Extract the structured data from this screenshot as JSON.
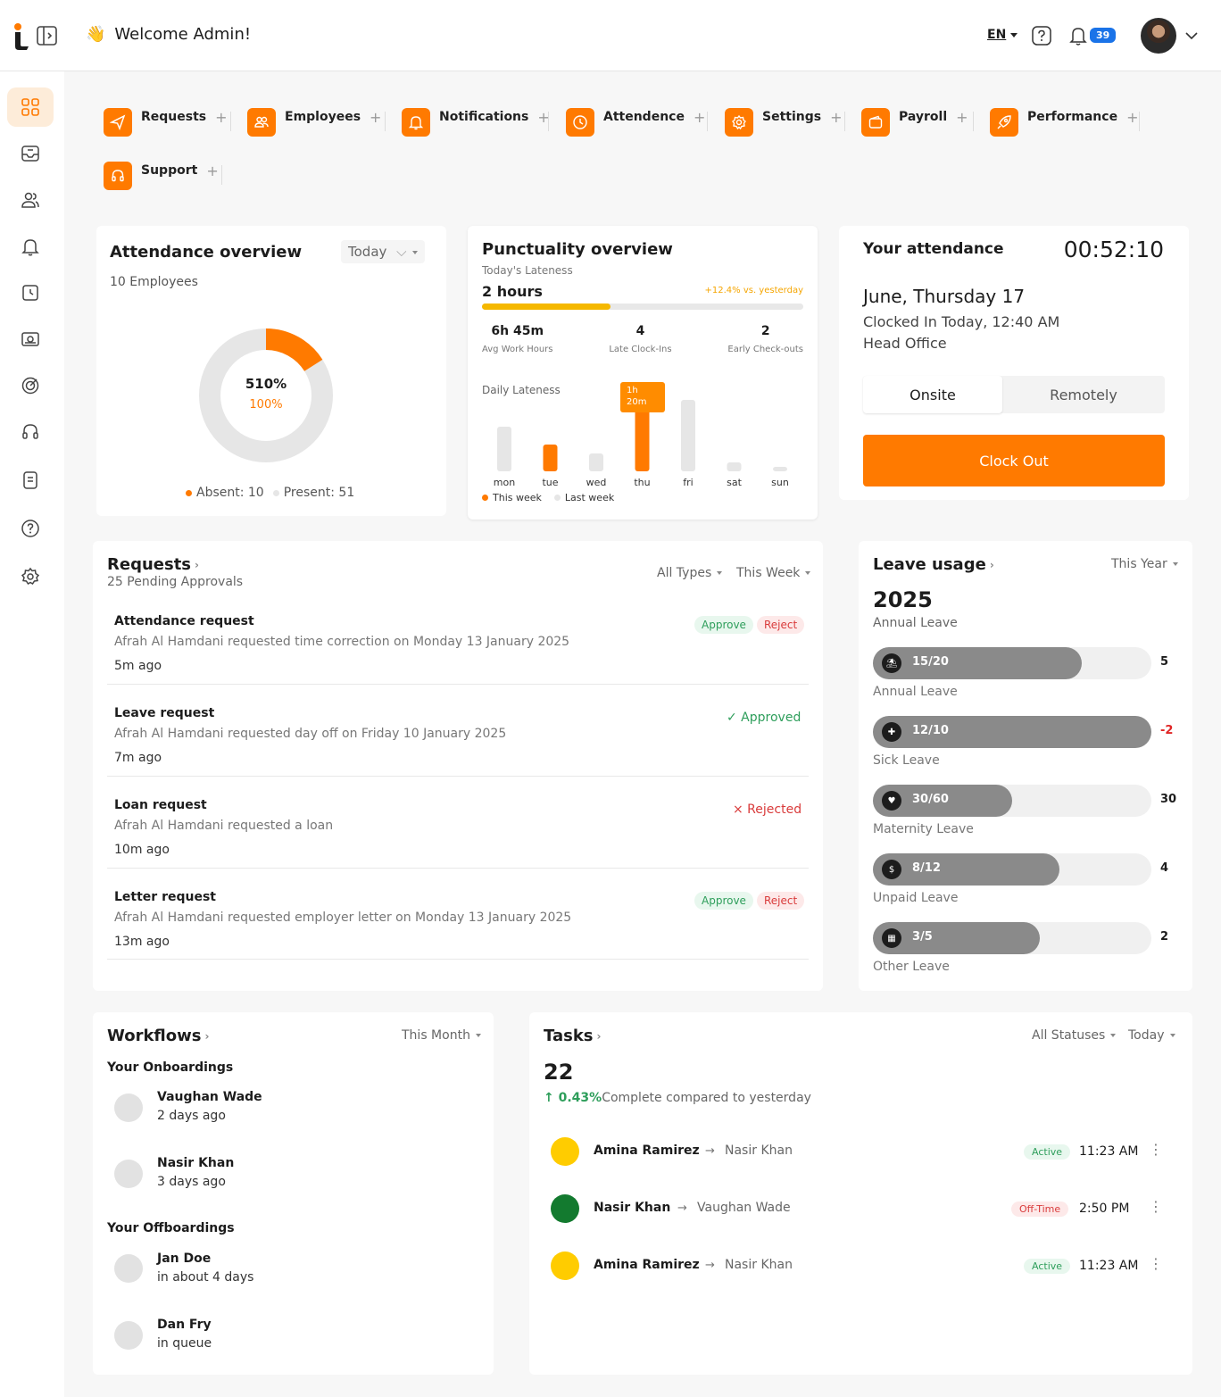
{
  "header": {
    "welcome": "Welcome Admin!",
    "language": "EN",
    "notifications_count": "39"
  },
  "sidebar": {
    "items": [
      {
        "icon": "dashboard-icon"
      },
      {
        "icon": "inbox-icon"
      },
      {
        "icon": "users-icon"
      },
      {
        "icon": "bell-icon"
      },
      {
        "icon": "clock-icon"
      },
      {
        "icon": "payroll-icon"
      },
      {
        "icon": "target-icon"
      },
      {
        "icon": "headset-icon"
      },
      {
        "icon": "notes-icon"
      },
      {
        "icon": "help-icon"
      },
      {
        "icon": "settings-icon"
      }
    ]
  },
  "quick_links": [
    {
      "label": "Requests",
      "plus": "+"
    },
    {
      "label": "Employees",
      "plus": "+"
    },
    {
      "label": "Notifications",
      "plus": "+"
    },
    {
      "label": "Attendence",
      "plus": "+"
    },
    {
      "label": "Settings",
      "plus": "+"
    },
    {
      "label": "Payroll",
      "plus": "+"
    },
    {
      "label": "Performance",
      "plus": "+"
    },
    {
      "label": "Support",
      "plus": "+"
    }
  ],
  "attendance_overview": {
    "title": "Attendance overview",
    "filter": "Today",
    "employees": "10 Employees",
    "center_value": "510%",
    "center_sub": "100%",
    "present_fraction": 0.16,
    "legend_absent": "Absent: 10",
    "legend_present": "Present: 51"
  },
  "punctuality": {
    "title": "Punctuality overview",
    "subtitle": "Today's Lateness",
    "value": "2 hours",
    "change": "+12.4% vs. yesterday",
    "progress": 0.4,
    "stats": [
      {
        "value": "6h 45m",
        "label": "Avg Work Hours"
      },
      {
        "value": "4",
        "label": "Late Clock-Ins"
      },
      {
        "value": "2",
        "label": "Early Check-outs"
      }
    ],
    "daily_title": "Daily Lateness",
    "tooltip_line1": "1h",
    "tooltip_line2": "20m",
    "legend_this": "This week",
    "legend_last": "Last week"
  },
  "chart_data": {
    "type": "bar",
    "categories": [
      "mon",
      "tue",
      "wed",
      "thu",
      "fri",
      "sat",
      "sun"
    ],
    "series": [
      {
        "name": "This week",
        "values": [
          0,
          30,
          0,
          80,
          0,
          0,
          0
        ]
      },
      {
        "name": "Last week",
        "values": [
          50,
          0,
          20,
          0,
          80,
          10,
          5
        ]
      }
    ],
    "xlabel": "",
    "ylabel": ""
  },
  "your_attendance": {
    "title": "Your attendance",
    "timer": "00:52:10",
    "date": "June, Thursday 17",
    "clocked": "Clocked In Today, 12:40 AM",
    "location": "Head Office",
    "tab_onsite": "Onsite",
    "tab_remote": "Remotely",
    "clock_out": "Clock Out"
  },
  "requests": {
    "title": "Requests",
    "subtitle": "25 Pending Approvals",
    "filter_types": "All Types",
    "filter_period": "This Week",
    "approve_label": "Approve",
    "reject_label": "Reject",
    "items": [
      {
        "title": "Attendance request",
        "desc": "Afrah Al Hamdani requested time correction on Monday 13 January 2025",
        "time": "5m ago",
        "status": ""
      },
      {
        "title": "Leave request",
        "desc": "Afrah Al Hamdani requested day off on Friday 10 January 2025",
        "time": "7m ago",
        "status": "✓ Approved"
      },
      {
        "title": "Loan request",
        "desc": "Afrah Al Hamdani requested a loan",
        "time": "10m ago",
        "status": "× Rejected"
      },
      {
        "title": "Letter request",
        "desc": "Afrah Al Hamdani requested employer letter on Monday 13 January 2025",
        "time": "13m ago",
        "status": ""
      }
    ]
  },
  "leave_usage": {
    "title": "Leave usage",
    "filter": "This Year",
    "year": "2025",
    "subtitle": "Annual Leave",
    "items": [
      {
        "value": "15/20",
        "remaining": "5",
        "label": "Annual Leave",
        "fraction": 0.75
      },
      {
        "value": "12/10",
        "remaining": "-2",
        "label": "Sick Leave",
        "fraction": 1.0
      },
      {
        "value": "30/60",
        "remaining": "30",
        "label": "Maternity Leave",
        "fraction": 0.5
      },
      {
        "value": "8/12",
        "remaining": "4",
        "label": "Unpaid Leave",
        "fraction": 0.67
      },
      {
        "value": "3/5",
        "remaining": "2",
        "label": "Other Leave",
        "fraction": 0.6
      }
    ]
  },
  "workflows": {
    "title": "Workflows",
    "filter": "This Month",
    "onboard_title": "Your Onboardings",
    "offboard_title": "Your Offboardings",
    "onboardings": [
      {
        "name": "Vaughan Wade",
        "time": "2 days ago"
      },
      {
        "name": "Nasir Khan",
        "time": "3 days ago"
      }
    ],
    "offboardings": [
      {
        "name": "Jan Doe",
        "time": "in about 4 days"
      },
      {
        "name": "Dan Fry",
        "time": "in queue"
      }
    ]
  },
  "tasks": {
    "title": "Tasks",
    "filter_status": "All Statuses",
    "filter_period": "Today",
    "count": "22",
    "change_value": "↑ 0.43%",
    "change_text": "Complete compared to yesterday",
    "items": [
      {
        "from": "Amina Ramirez",
        "to": "Nasir Khan",
        "status": "Active",
        "time": "11:23 AM",
        "color": "#ffcc00"
      },
      {
        "from": "Nasir Khan",
        "to": "Vaughan Wade",
        "status": "Off-Time",
        "time": "2:50 PM",
        "color": "#137a2f"
      },
      {
        "from": "Amina Ramirez",
        "to": "Nasir Khan",
        "status": "Active",
        "time": "11:23 AM",
        "color": "#ffcc00"
      }
    ]
  },
  "colors": {
    "accent": "#ff7a00",
    "progress": "#f5b800"
  }
}
